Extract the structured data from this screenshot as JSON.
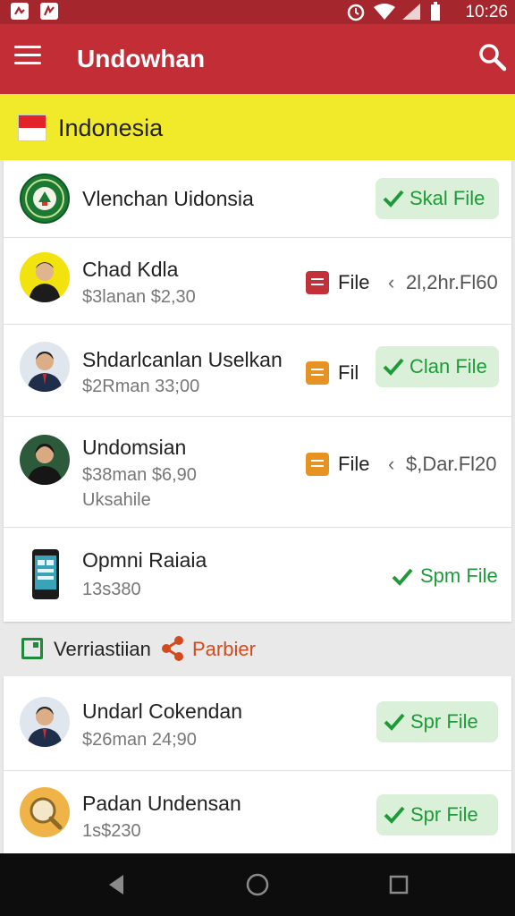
{
  "status_bar": {
    "time": "10:26"
  },
  "app_bar": {
    "title": "Undowhan"
  },
  "country": {
    "name": "Indonesia"
  },
  "list1": [
    {
      "name": "Vlenchan Uidonsia",
      "action": "Skal File"
    },
    {
      "name": "Chad Kdla",
      "sub": "$3lanan $2,30",
      "file_label": "File",
      "meta": "2l,2hr.Fl60"
    },
    {
      "name": "Shdarlcanlan Uselkan",
      "sub": "$2Rman 33;00",
      "file_label": "Fil",
      "action": "Clan File"
    },
    {
      "name": "Undomsian",
      "sub": "$38man $6,90",
      "sub2": "Uksahile",
      "file_label": "File",
      "meta": "$,Dar.Fl20"
    },
    {
      "name": "Opmni Raiaia",
      "sub": "13s380",
      "action": "Spm File"
    }
  ],
  "section": {
    "label": "Verriastiian",
    "share_label": "Parbier"
  },
  "list2": [
    {
      "name": "Undarl Cokendan",
      "sub": "$26man 24;90",
      "action": "Spr File"
    },
    {
      "name": "Padan Undensan",
      "sub": "1s$230",
      "action": "Spr File"
    }
  ],
  "colors": {
    "status_bar": "#a5262c",
    "app_bar": "#c32d35",
    "country_bar": "#f0ea2b",
    "accent_green": "#1e9a3a",
    "share_orange": "#d24a1e"
  }
}
